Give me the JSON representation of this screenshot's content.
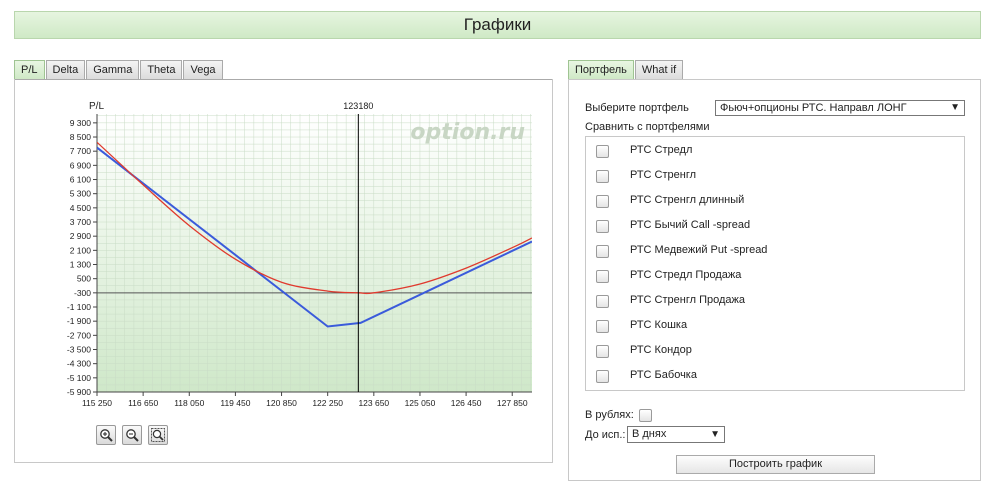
{
  "page": {
    "title": "Графики"
  },
  "chart_tabs": [
    "P/L",
    "Delta",
    "Gamma",
    "Theta",
    "Vega"
  ],
  "right_tabs": [
    "Портфель",
    "What if"
  ],
  "chart": {
    "watermark": "option.ru",
    "zoom_in_icon": "zoom-in-icon",
    "zoom_out_icon": "zoom-out-icon",
    "zoom_fit_icon": "zoom-fit-icon",
    "colors": {
      "pl_expiry": "#3b5bdb",
      "pl_today": "#e03a2e",
      "grid": "#c9dcc6",
      "bg_top": "#ffffff",
      "bg_bottom": "#cfe8c9"
    }
  },
  "chart_data": {
    "type": "line",
    "ylabel": "P/L",
    "xlim": [
      115250,
      128450
    ],
    "ylim": [
      -5900,
      9800
    ],
    "x_ticks": [
      "115 250",
      "116 650",
      "118 050",
      "119 450",
      "120 850",
      "122 250",
      "123 650",
      "125 050",
      "126 450",
      "127 850"
    ],
    "x_tick_values": [
      115250,
      116650,
      118050,
      119450,
      120850,
      122250,
      123650,
      125050,
      126450,
      127850
    ],
    "y_ticks": [
      "9 300",
      "8 500",
      "7 700",
      "6 900",
      "6 100",
      "5 300",
      "4 500",
      "3 700",
      "2 900",
      "2 100",
      "1 300",
      "500",
      "-300",
      "-1 100",
      "-1 900",
      "-2 700",
      "-3 500",
      "-4 300",
      "-5 100",
      "-5 900"
    ],
    "y_tick_values": [
      9300,
      8500,
      7700,
      6900,
      6100,
      5300,
      4500,
      3700,
      2900,
      2100,
      1300,
      500,
      -300,
      -1100,
      -1900,
      -2700,
      -3500,
      -4300,
      -5100,
      -5900
    ],
    "zero_line": -300,
    "current_price": 123180,
    "current_price_label": "123180",
    "series": [
      {
        "x": [
          115250,
          122250,
          123250,
          128450
        ],
        "y": [
          7900,
          -2200,
          -2000,
          2600
        ]
      },
      {
        "x": [
          115250,
          116650,
          118050,
          119450,
          120850,
          122250,
          123180,
          123650,
          125050,
          126450,
          127850,
          128450
        ],
        "y": [
          8200,
          5800,
          3500,
          1600,
          300,
          -200,
          -300,
          -300,
          200,
          1100,
          2250,
          2800
        ]
      }
    ]
  },
  "portfolio": {
    "select_label": "Выберите портфель",
    "selected": "Фьюч+опционы РТС. Направл ЛОНГ",
    "compare_label": "Сравнить с портфелями",
    "compare_items": [
      {
        "label": "РТС Стредл"
      },
      {
        "label": "РТС Стренгл"
      },
      {
        "label": "РТС Стренгл длинный"
      },
      {
        "label": "РТС Бычий Call -spread"
      },
      {
        "label": "РТС Медвежий Put -spread"
      },
      {
        "label": "РТС Стредл Продажа"
      },
      {
        "label": "РТС Стренгл Продажа"
      },
      {
        "label": "РТС Кошка"
      },
      {
        "label": "РТС Кондор"
      },
      {
        "label": "РТС Бабочка"
      }
    ],
    "rubles_label": "В рублях:",
    "expiry_label": "До исп.:",
    "expiry_selected": "В днях",
    "build_button": "Построить график"
  }
}
